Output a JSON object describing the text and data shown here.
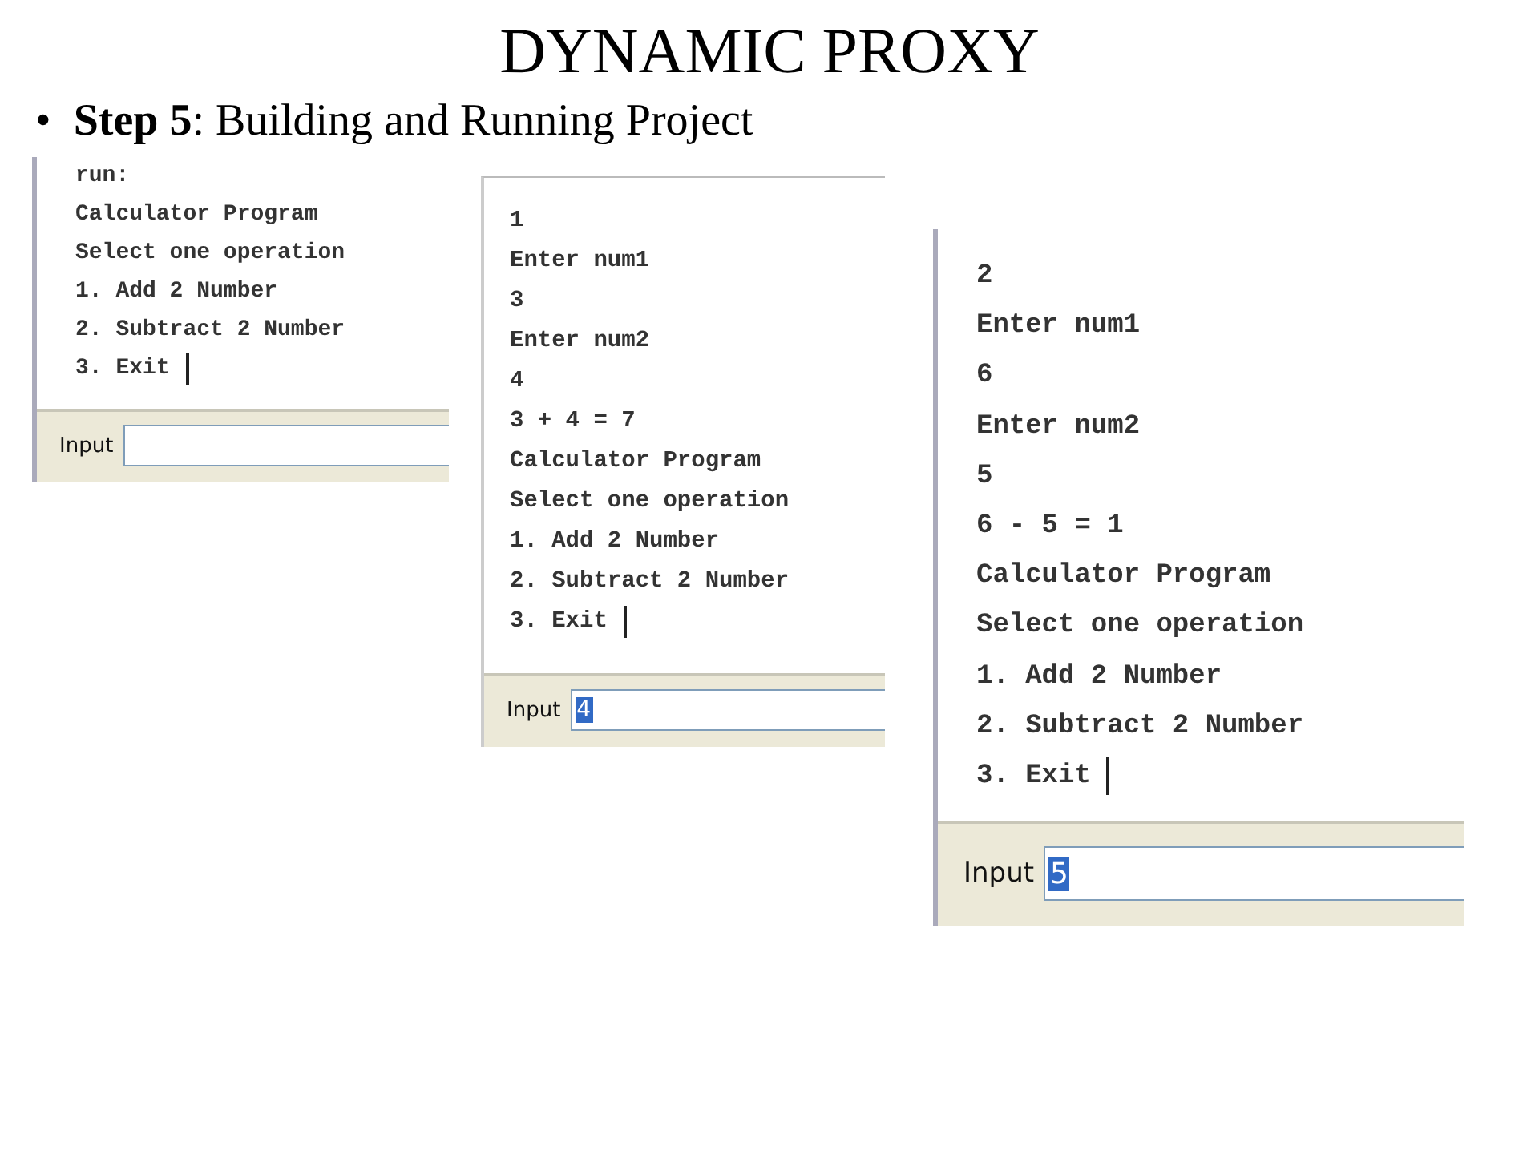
{
  "slide": {
    "title": "DYNAMIC PROXY",
    "bullet": "•",
    "text": "**Step 5**: Building and Running Project"
  },
  "consoles": [
    {
      "lines": [
        "run:",
        "Calculator Program",
        "Select one operation",
        "1. Add 2 Number",
        "2. Subtract 2 Number",
        "3. Exit"
      ],
      "cursor": true,
      "input_label": "Input"
    },
    {
      "lines": [
        "1",
        "Enter num1",
        "3",
        "Enter num2",
        "4",
        "3 + 4 = 7",
        "Calculator Program",
        "Select one operation",
        "1. Add 2 Number",
        "2. Subtract 2 Number",
        "3. Exit"
      ],
      "cursor": true,
      "input_label": "Input",
      "input_value": "4",
      "value_selected": true
    },
    {
      "lines": [
        "2",
        "Enter num1",
        "6",
        "Enter num2",
        "5",
        "6 - 5 = 1",
        "Calculator Program",
        "Select one operation",
        "1. Add 2 Number",
        "2. Subtract 2 Number",
        "3. Exit"
      ],
      "cursor": true,
      "input_label": "Input",
      "input_value": "5",
      "value_selected": true
    }
  ]
}
